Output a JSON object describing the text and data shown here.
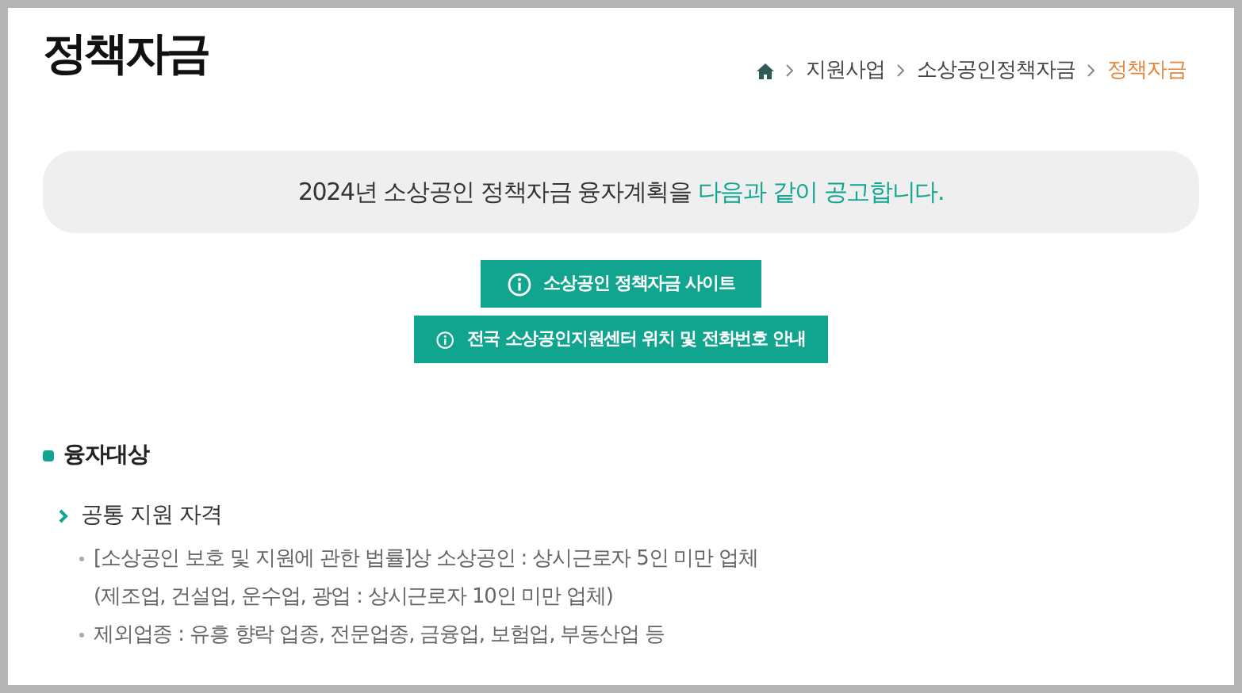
{
  "page_title": "정책자금",
  "breadcrumb": [
    {
      "label": "지원사업",
      "current": false
    },
    {
      "label": "소상공인정책자금",
      "current": false
    },
    {
      "label": "정책자금",
      "current": true
    }
  ],
  "notice": {
    "text": "2024년 소상공인 정책자금 융자계획을 ",
    "highlight": "다음과 같이 공고합니다."
  },
  "buttons": [
    "소상공인 정책자금 사이트",
    "전국 소상공인지원센터 위치 및 전화번호 안내"
  ],
  "section": {
    "heading": "융자대상",
    "subheading": "공통 지원 자격",
    "items": [
      {
        "lines": [
          "[소상공인 보호 및 지원에 관한 법률]상 소상공인 : 상시근로자 5인 미만 업체",
          "(제조업, 건설업, 운수업, 광업 : 상시근로자 10인 미만 업체)"
        ]
      },
      {
        "lines": [
          "제외업종 : 유흥 향락 업종, 전문업종, 금융업, 보험업, 부동산업 등"
        ]
      }
    ]
  }
}
